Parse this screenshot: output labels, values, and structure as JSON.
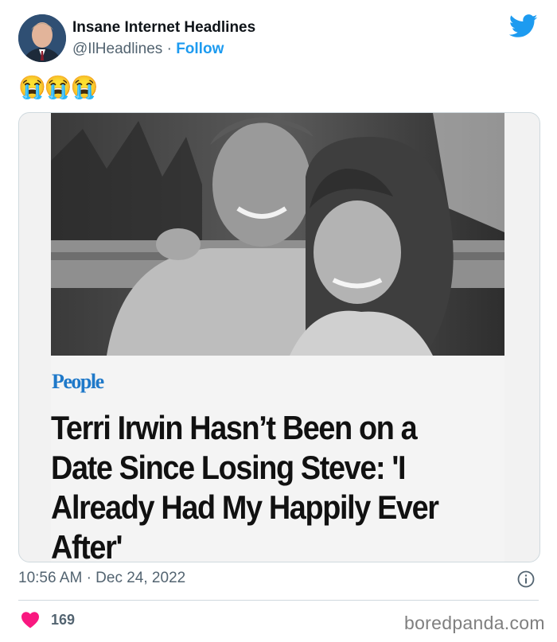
{
  "header": {
    "display_name": "Insane Internet Headlines",
    "handle": "@IlHeadlines",
    "separator": "·",
    "follow_label": "Follow"
  },
  "tweet": {
    "text": "😭😭😭"
  },
  "article": {
    "publisher": "People",
    "headline": "Terri Irwin Hasn’t Been on a Date Since Losing Steve: 'I Already Had My Happily Ever After'"
  },
  "meta": {
    "time": "10:56 AM",
    "separator": "·",
    "date": "Dec 24, 2022"
  },
  "engagement": {
    "likes": "169"
  },
  "footer": {
    "watermark": "boredpanda.com"
  },
  "colors": {
    "accent": "#1d9bf0",
    "like": "#f91880",
    "muted": "#536471",
    "publisher": "#1f79c9"
  }
}
